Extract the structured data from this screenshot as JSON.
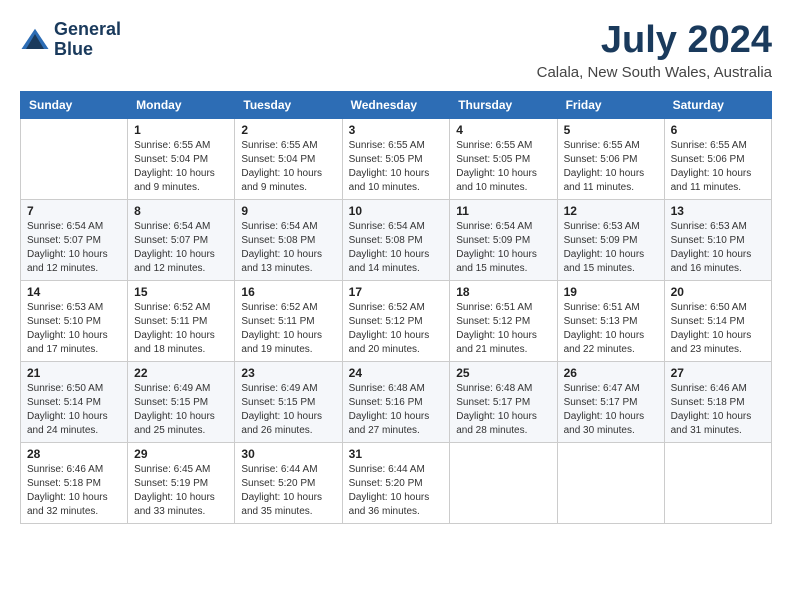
{
  "logo": {
    "line1": "General",
    "line2": "Blue"
  },
  "title": "July 2024",
  "location": "Calala, New South Wales, Australia",
  "weekdays": [
    "Sunday",
    "Monday",
    "Tuesday",
    "Wednesday",
    "Thursday",
    "Friday",
    "Saturday"
  ],
  "weeks": [
    [
      {
        "day": "",
        "sunrise": "",
        "sunset": "",
        "daylight": ""
      },
      {
        "day": "1",
        "sunrise": "Sunrise: 6:55 AM",
        "sunset": "Sunset: 5:04 PM",
        "daylight": "Daylight: 10 hours and 9 minutes."
      },
      {
        "day": "2",
        "sunrise": "Sunrise: 6:55 AM",
        "sunset": "Sunset: 5:04 PM",
        "daylight": "Daylight: 10 hours and 9 minutes."
      },
      {
        "day": "3",
        "sunrise": "Sunrise: 6:55 AM",
        "sunset": "Sunset: 5:05 PM",
        "daylight": "Daylight: 10 hours and 10 minutes."
      },
      {
        "day": "4",
        "sunrise": "Sunrise: 6:55 AM",
        "sunset": "Sunset: 5:05 PM",
        "daylight": "Daylight: 10 hours and 10 minutes."
      },
      {
        "day": "5",
        "sunrise": "Sunrise: 6:55 AM",
        "sunset": "Sunset: 5:06 PM",
        "daylight": "Daylight: 10 hours and 11 minutes."
      },
      {
        "day": "6",
        "sunrise": "Sunrise: 6:55 AM",
        "sunset": "Sunset: 5:06 PM",
        "daylight": "Daylight: 10 hours and 11 minutes."
      }
    ],
    [
      {
        "day": "7",
        "sunrise": "Sunrise: 6:54 AM",
        "sunset": "Sunset: 5:07 PM",
        "daylight": "Daylight: 10 hours and 12 minutes."
      },
      {
        "day": "8",
        "sunrise": "Sunrise: 6:54 AM",
        "sunset": "Sunset: 5:07 PM",
        "daylight": "Daylight: 10 hours and 12 minutes."
      },
      {
        "day": "9",
        "sunrise": "Sunrise: 6:54 AM",
        "sunset": "Sunset: 5:08 PM",
        "daylight": "Daylight: 10 hours and 13 minutes."
      },
      {
        "day": "10",
        "sunrise": "Sunrise: 6:54 AM",
        "sunset": "Sunset: 5:08 PM",
        "daylight": "Daylight: 10 hours and 14 minutes."
      },
      {
        "day": "11",
        "sunrise": "Sunrise: 6:54 AM",
        "sunset": "Sunset: 5:09 PM",
        "daylight": "Daylight: 10 hours and 15 minutes."
      },
      {
        "day": "12",
        "sunrise": "Sunrise: 6:53 AM",
        "sunset": "Sunset: 5:09 PM",
        "daylight": "Daylight: 10 hours and 15 minutes."
      },
      {
        "day": "13",
        "sunrise": "Sunrise: 6:53 AM",
        "sunset": "Sunset: 5:10 PM",
        "daylight": "Daylight: 10 hours and 16 minutes."
      }
    ],
    [
      {
        "day": "14",
        "sunrise": "Sunrise: 6:53 AM",
        "sunset": "Sunset: 5:10 PM",
        "daylight": "Daylight: 10 hours and 17 minutes."
      },
      {
        "day": "15",
        "sunrise": "Sunrise: 6:52 AM",
        "sunset": "Sunset: 5:11 PM",
        "daylight": "Daylight: 10 hours and 18 minutes."
      },
      {
        "day": "16",
        "sunrise": "Sunrise: 6:52 AM",
        "sunset": "Sunset: 5:11 PM",
        "daylight": "Daylight: 10 hours and 19 minutes."
      },
      {
        "day": "17",
        "sunrise": "Sunrise: 6:52 AM",
        "sunset": "Sunset: 5:12 PM",
        "daylight": "Daylight: 10 hours and 20 minutes."
      },
      {
        "day": "18",
        "sunrise": "Sunrise: 6:51 AM",
        "sunset": "Sunset: 5:12 PM",
        "daylight": "Daylight: 10 hours and 21 minutes."
      },
      {
        "day": "19",
        "sunrise": "Sunrise: 6:51 AM",
        "sunset": "Sunset: 5:13 PM",
        "daylight": "Daylight: 10 hours and 22 minutes."
      },
      {
        "day": "20",
        "sunrise": "Sunrise: 6:50 AM",
        "sunset": "Sunset: 5:14 PM",
        "daylight": "Daylight: 10 hours and 23 minutes."
      }
    ],
    [
      {
        "day": "21",
        "sunrise": "Sunrise: 6:50 AM",
        "sunset": "Sunset: 5:14 PM",
        "daylight": "Daylight: 10 hours and 24 minutes."
      },
      {
        "day": "22",
        "sunrise": "Sunrise: 6:49 AM",
        "sunset": "Sunset: 5:15 PM",
        "daylight": "Daylight: 10 hours and 25 minutes."
      },
      {
        "day": "23",
        "sunrise": "Sunrise: 6:49 AM",
        "sunset": "Sunset: 5:15 PM",
        "daylight": "Daylight: 10 hours and 26 minutes."
      },
      {
        "day": "24",
        "sunrise": "Sunrise: 6:48 AM",
        "sunset": "Sunset: 5:16 PM",
        "daylight": "Daylight: 10 hours and 27 minutes."
      },
      {
        "day": "25",
        "sunrise": "Sunrise: 6:48 AM",
        "sunset": "Sunset: 5:17 PM",
        "daylight": "Daylight: 10 hours and 28 minutes."
      },
      {
        "day": "26",
        "sunrise": "Sunrise: 6:47 AM",
        "sunset": "Sunset: 5:17 PM",
        "daylight": "Daylight: 10 hours and 30 minutes."
      },
      {
        "day": "27",
        "sunrise": "Sunrise: 6:46 AM",
        "sunset": "Sunset: 5:18 PM",
        "daylight": "Daylight: 10 hours and 31 minutes."
      }
    ],
    [
      {
        "day": "28",
        "sunrise": "Sunrise: 6:46 AM",
        "sunset": "Sunset: 5:18 PM",
        "daylight": "Daylight: 10 hours and 32 minutes."
      },
      {
        "day": "29",
        "sunrise": "Sunrise: 6:45 AM",
        "sunset": "Sunset: 5:19 PM",
        "daylight": "Daylight: 10 hours and 33 minutes."
      },
      {
        "day": "30",
        "sunrise": "Sunrise: 6:44 AM",
        "sunset": "Sunset: 5:20 PM",
        "daylight": "Daylight: 10 hours and 35 minutes."
      },
      {
        "day": "31",
        "sunrise": "Sunrise: 6:44 AM",
        "sunset": "Sunset: 5:20 PM",
        "daylight": "Daylight: 10 hours and 36 minutes."
      },
      {
        "day": "",
        "sunrise": "",
        "sunset": "",
        "daylight": ""
      },
      {
        "day": "",
        "sunrise": "",
        "sunset": "",
        "daylight": ""
      },
      {
        "day": "",
        "sunrise": "",
        "sunset": "",
        "daylight": ""
      }
    ]
  ]
}
